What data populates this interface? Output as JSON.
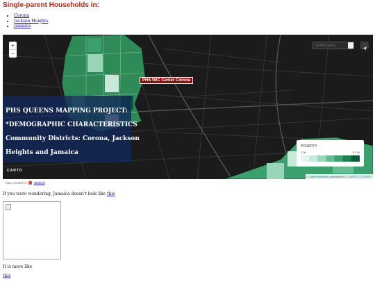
{
  "page": {
    "title": "Single-parent Households in:"
  },
  "nav": {
    "links": [
      "Corona",
      "Jackson Heights",
      "Jamaica"
    ]
  },
  "map": {
    "zoom_in": "+",
    "zoom_out": "−",
    "search_placeholder": "Visible layers",
    "popup": "PHS WIC Center Corona",
    "info_lines": [
      "PHS QUEENS MAPPING PROJECT:",
      "*DEMOGRAPHIC CHARACTERISTICS",
      "Community Districts: Corona, Jackson",
      "Heights and Jamaica"
    ],
    "legend": {
      "title": "POVERTY",
      "min": "0.00",
      "max": "87.45",
      "colors": [
        "#e5f5f0",
        "#c7e9da",
        "#99d5b9",
        "#66bd94",
        "#3ba06e",
        "#1f7f4f",
        "#0b5c36"
      ]
    },
    "carto_logo": "CARTO",
    "attribution": {
      "link1": "OpenStreetMap",
      "text": " contributors © ",
      "link2": "CARTO",
      "text2": ", © ",
      "link3": "CARTO"
    }
  },
  "credit": {
    "prefix": "Map created by",
    "link": "mlarked"
  },
  "body": {
    "line1_text": "If you were wondering, Jamaica doesn't look like ",
    "line1_link": "this",
    "line2_text": "It is more like",
    "line2_link": "this"
  }
}
